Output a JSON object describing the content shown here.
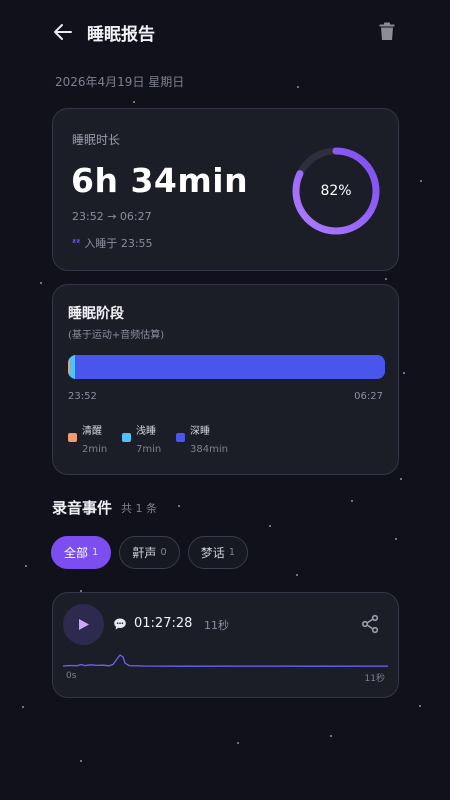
{
  "header": {
    "title": "睡眠报告",
    "back_icon": "arrow-left-icon",
    "delete_icon": "trash-icon"
  },
  "date_line": "2026年4月19日 星期日",
  "duration_card": {
    "label": "睡眠时长",
    "value": "6h 34min",
    "time_range": "23:52 → 06:27",
    "fell_asleep_icon": "zzz-icon",
    "fell_asleep": "入睡于 23:55",
    "score_text": "82%",
    "score_fraction": 0.82
  },
  "stages_card": {
    "title": "睡眠阶段",
    "subtitle": "(基于运动+音频估算)",
    "start": "23:52",
    "end": "06:27",
    "stages": [
      {
        "name": "清醒",
        "value": "2min",
        "minutes": 2,
        "color": "#f29a76"
      },
      {
        "name": "浅睡",
        "value": "7min",
        "minutes": 7,
        "color": "#4fc3f7"
      },
      {
        "name": "深睡",
        "value": "384min",
        "minutes": 384,
        "color": "#4a55ee"
      }
    ]
  },
  "events": {
    "title": "录音事件",
    "count_text": "共 1 条",
    "filters": [
      {
        "label": "全部",
        "count": "1",
        "active": true
      },
      {
        "label": "鼾声",
        "count": "0",
        "active": false
      },
      {
        "label": "梦话",
        "count": "1",
        "active": false
      }
    ],
    "items": [
      {
        "type_icon": "speech-bubble-icon",
        "time": "01:27:28",
        "duration": "11秒",
        "wave_start": "0s",
        "wave_end": "11秒"
      }
    ]
  },
  "colors": {
    "background": "#10111a",
    "card": "#1b1d27",
    "accent": "#7c4ef0",
    "ring_track": "#2d2f3d",
    "deep_sleep": "#4a55ee"
  }
}
